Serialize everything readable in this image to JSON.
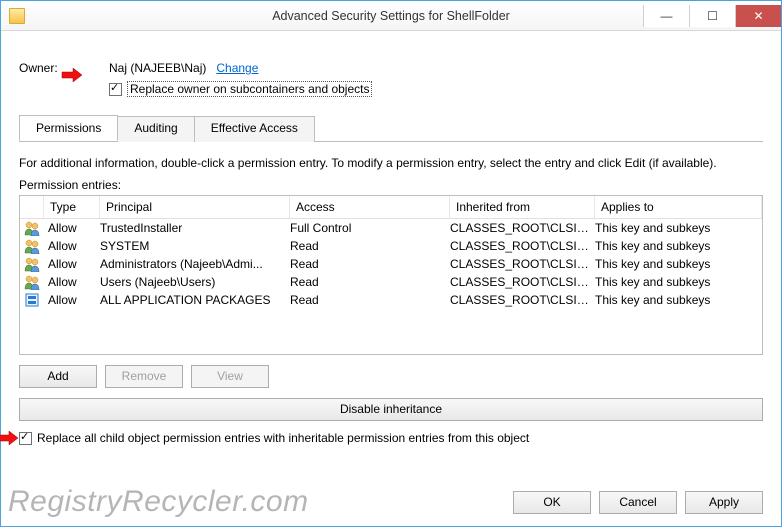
{
  "window": {
    "title": "Advanced Security Settings for ShellFolder"
  },
  "owner": {
    "label": "Owner:",
    "name": "Naj (NAJEEB\\Naj)",
    "change_link": "Change",
    "replace_checkbox_label": "Replace owner on subcontainers and objects"
  },
  "tabs": [
    {
      "label": "Permissions",
      "active": true
    },
    {
      "label": "Auditing",
      "active": false
    },
    {
      "label": "Effective Access",
      "active": false
    }
  ],
  "info_text": "For additional information, double-click a permission entry. To modify a permission entry, select the entry and click Edit (if available).",
  "entries_label": "Permission entries:",
  "columns": {
    "type": "Type",
    "principal": "Principal",
    "access": "Access",
    "inherited": "Inherited from",
    "applies": "Applies to"
  },
  "entries": [
    {
      "icon": "users",
      "type": "Allow",
      "principal": "TrustedInstaller",
      "access": "Full Control",
      "inherited": "CLASSES_ROOT\\CLSID...",
      "applies": "This key and subkeys"
    },
    {
      "icon": "users",
      "type": "Allow",
      "principal": "SYSTEM",
      "access": "Read",
      "inherited": "CLASSES_ROOT\\CLSID...",
      "applies": "This key and subkeys"
    },
    {
      "icon": "users",
      "type": "Allow",
      "principal": "Administrators (Najeeb\\Admi...",
      "access": "Read",
      "inherited": "CLASSES_ROOT\\CLSID...",
      "applies": "This key and subkeys"
    },
    {
      "icon": "users",
      "type": "Allow",
      "principal": "Users (Najeeb\\Users)",
      "access": "Read",
      "inherited": "CLASSES_ROOT\\CLSID...",
      "applies": "This key and subkeys"
    },
    {
      "icon": "package",
      "type": "Allow",
      "principal": "ALL APPLICATION PACKAGES",
      "access": "Read",
      "inherited": "CLASSES_ROOT\\CLSID...",
      "applies": "This key and subkeys"
    }
  ],
  "buttons": {
    "add": "Add",
    "remove": "Remove",
    "view": "View",
    "disable_inheritance": "Disable inheritance",
    "ok": "OK",
    "cancel": "Cancel",
    "apply": "Apply"
  },
  "replace_child_label": "Replace all child object permission entries with inheritable permission entries from this object",
  "watermark": "RegistryRecycler.com"
}
